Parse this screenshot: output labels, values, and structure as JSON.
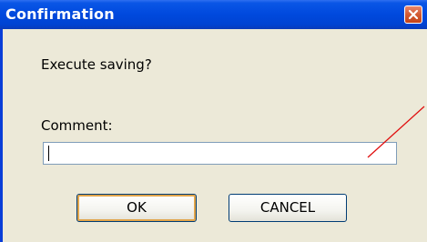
{
  "dialog": {
    "title": "Confirmation",
    "message": "Execute saving?",
    "comment_label": "Comment:",
    "comment_value": "",
    "ok_label": "OK",
    "cancel_label": "CANCEL"
  },
  "colors": {
    "titlebar": "#0049dd",
    "window_bg": "#ece9d8",
    "close_button": "#d25a32",
    "annotation_line": "#e01010"
  },
  "icons": {
    "close": "close-icon"
  }
}
